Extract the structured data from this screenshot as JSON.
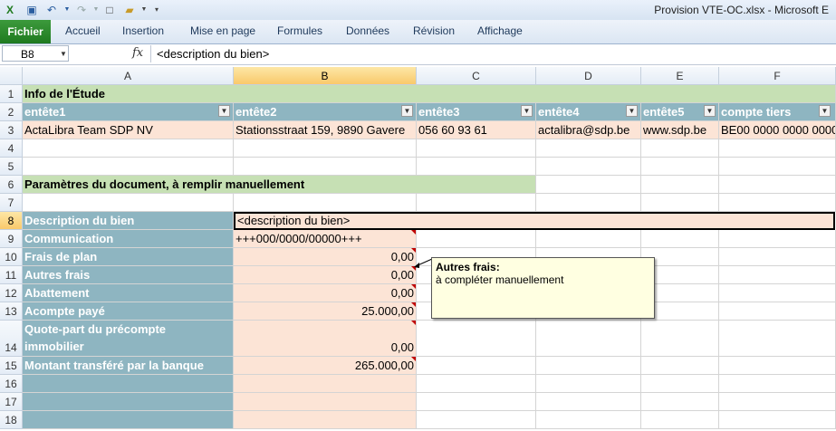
{
  "window": {
    "title": "Provision VTE-OC.xlsx  -  Microsoft E"
  },
  "ribbon": {
    "file": "Fichier",
    "tabs": [
      "Accueil",
      "Insertion",
      "Mise en page",
      "Formules",
      "Données",
      "Révision",
      "Affichage"
    ]
  },
  "formula_bar": {
    "name_box": "B8",
    "fx": "fx",
    "content": "<description du bien>"
  },
  "columns": [
    "A",
    "B",
    "C",
    "D",
    "E",
    "F"
  ],
  "rows": [
    "1",
    "2",
    "3",
    "4",
    "5",
    "6",
    "7",
    "8",
    "9",
    "10",
    "11",
    "12",
    "13",
    "14",
    "15",
    "16",
    "17",
    "18"
  ],
  "cells": {
    "r1": "Info de l'Étude",
    "headers": [
      "entête1",
      "entête2",
      "entête3",
      "entête4",
      "entête5",
      "compte tiers"
    ],
    "r3": [
      "ActaLibra Team SDP NV",
      "Stationsstraat 159, 9890 Gavere",
      "056 60 93 61",
      "actalibra@sdp.be",
      "www.sdp.be",
      "BE00 0000 0000 0000"
    ],
    "r6": "Paramètres du document, à remplir manuellement",
    "labels": {
      "r8": "Description du bien",
      "r9": "Communication",
      "r10": "Frais de plan",
      "r11": "Autres frais",
      "r12": "Abattement",
      "r13": "Acompte payé",
      "r14a": "Quote-part du précompte",
      "r14b": "immobilier",
      "r15": "Montant transféré par la banque"
    },
    "values": {
      "r8": "<description du bien>",
      "r9": "+++000/0000/00000+++",
      "r10": "0,00",
      "r11": "0,00",
      "r12": "0,00",
      "r13": "25.000,00",
      "r14": "0,00",
      "r15": "265.000,00"
    }
  },
  "comment": {
    "title": "Autres frais:",
    "body": "à compléter manuellement"
  }
}
